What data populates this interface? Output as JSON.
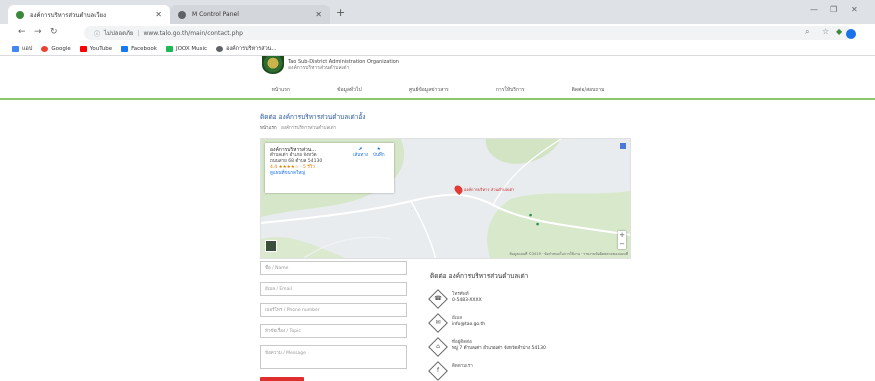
{
  "browser": {
    "tabs": [
      {
        "title": "องค์การบริหารส่วนตำบลเวียง",
        "active": true
      },
      {
        "title": "M Control Panel",
        "active": false
      }
    ],
    "address": {
      "security_label": "ไม่ปลอดภัย",
      "url": "www.talo.go.th/main/contact.php"
    },
    "bookmarks": [
      {
        "label": "แอป",
        "icon": "apps-icon",
        "color": "#4285f4"
      },
      {
        "label": "Google",
        "icon": "google-icon",
        "color": "#ea4335"
      },
      {
        "label": "YouTube",
        "icon": "youtube-icon",
        "color": "#ff0000"
      },
      {
        "label": "Facebook",
        "icon": "facebook-icon",
        "color": "#1877f2"
      },
      {
        "label": "JOOX Music",
        "icon": "joox-icon",
        "color": "#1db954"
      },
      {
        "label": "องค์การบริหารส่วน...",
        "icon": "globe-icon",
        "color": "#5f6368"
      }
    ]
  },
  "site": {
    "org_name_line1": "Tao Sub-District Administration Organization",
    "org_name_line2": "องค์การบริหารส่วนตำบลเต่า",
    "nav": [
      "หน้าแรก",
      "ข้อมูลทั่วไป",
      "ศูนย์ข้อมูลข่าวสาร",
      "การให้บริการ",
      "ติดต่อ/สอบถาม"
    ]
  },
  "page": {
    "title": "ติดต่อ องค์การบริหารส่วนตำบลเต่าอั้ง",
    "breadcrumb_home": "หน้าแรก",
    "breadcrumb_current": "องค์การบริหารส่วนตำบลเต่า"
  },
  "map": {
    "card_name": "องค์การบริหารส่วน...",
    "card_address_1": "ตำบลเต่า อำเภอ จังหวัด",
    "card_address_2": "ถนนสาย 68 ตำบล 54130",
    "card_rating": "4.4 ★★★★☆ · 5 รีวิว",
    "card_link": "ดูแผนที่ขนาดใหญ่",
    "directions_label": "เส้นทาง",
    "save_label": "บันทึก",
    "pin_label": "องค์การบริหาร ส่วนตำบลเต่า",
    "credit": "ข้อมูลแผนที่ ©2019 · ข้อกำหนดในการใช้งาน · รายงานข้อผิดพลาดของแผนที่",
    "zoom_in": "+",
    "zoom_out": "−"
  },
  "form": {
    "name_placeholder": "ชื่อ / Name",
    "email_placeholder": "อีเมล / Email",
    "phone_placeholder": "เบอร์โทร / Phone number",
    "subject_placeholder": "หัวข้อเรื่อง / Topic",
    "message_placeholder": "ข้อความ / Message"
  },
  "contact": {
    "title": "ติดต่อ องค์การบริหารส่วนตำบลเต่า",
    "items": [
      {
        "icon": "phone-icon",
        "glyph": "☎",
        "label": "โทรศัพท์",
        "value": "0-5483-XXXX"
      },
      {
        "icon": "email-icon",
        "glyph": "✉",
        "label": "อีเมล",
        "value": "info@tao.go.th"
      },
      {
        "icon": "location-icon",
        "glyph": "⌂",
        "label": "ที่อยู่ติดต่อ",
        "value": "หมู่ 7 ตำบลเต่า อำเภอเต่า จังหวัดลำปาง 54130"
      },
      {
        "icon": "social-icon",
        "glyph": "f",
        "label": "ติดตามเรา",
        "value": ""
      }
    ]
  }
}
